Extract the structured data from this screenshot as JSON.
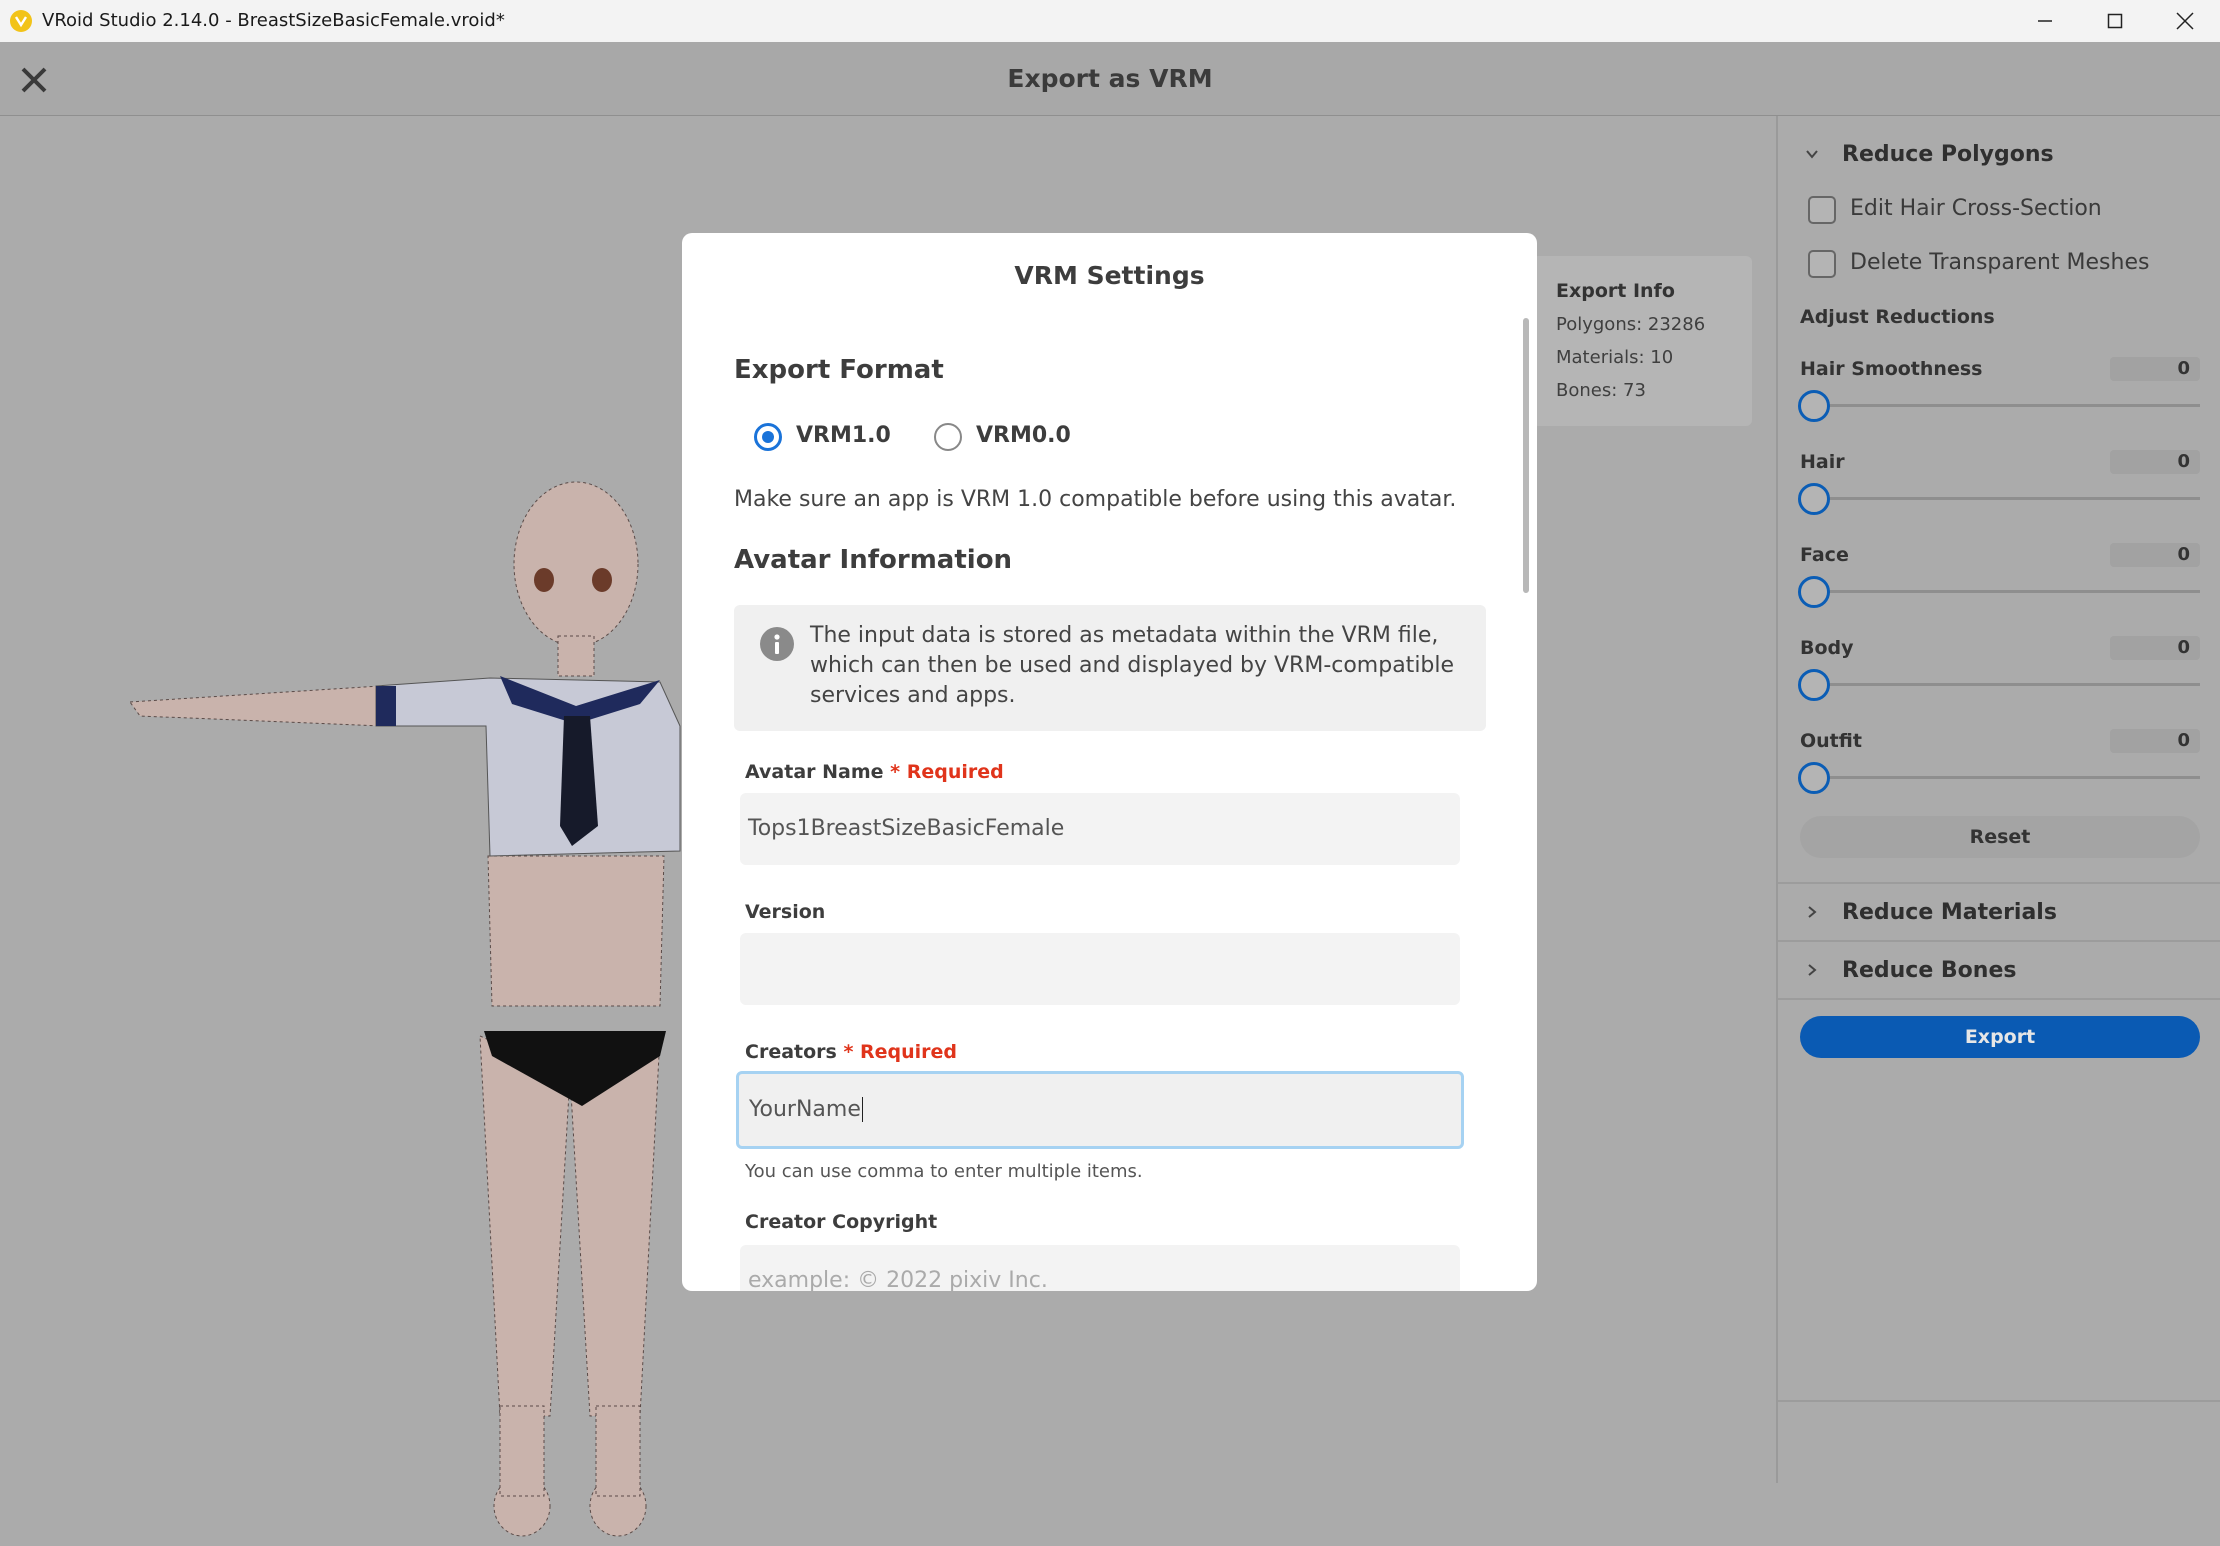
{
  "window": {
    "title": "VRoid Studio 2.14.0 - BreastSizeBasicFemale.vroid*"
  },
  "header": {
    "title": "Export as VRM"
  },
  "export_info": {
    "title": "Export Info",
    "polygons": "Polygons: 23286",
    "materials": "Materials: 10",
    "bones": "Bones: 73"
  },
  "panel": {
    "reduce_polygons": "Reduce Polygons",
    "edit_hair_cross_section": "Edit Hair Cross-Section",
    "delete_transparent_meshes": "Delete Transparent Meshes",
    "adjust_reductions": "Adjust Reductions",
    "sliders": [
      {
        "label": "Hair Smoothness",
        "value": "0"
      },
      {
        "label": "Hair",
        "value": "0"
      },
      {
        "label": "Face",
        "value": "0"
      },
      {
        "label": "Body",
        "value": "0"
      },
      {
        "label": "Outfit",
        "value": "0"
      }
    ],
    "reset": "Reset",
    "reduce_materials": "Reduce Materials",
    "reduce_bones": "Reduce Bones",
    "export": "Export"
  },
  "modal": {
    "title": "VRM Settings",
    "export_format": "Export Format",
    "vrm1": "VRM1.0",
    "vrm0": "VRM0.0",
    "compat_note": "Make sure an app is VRM 1.0 compatible before using this avatar.",
    "avatar_information": "Avatar Information",
    "info_text": "The input data is stored as metadata within the VRM file, which can then be used and displayed by VRM-compatible services and apps.",
    "avatar_name_label": "Avatar Name",
    "required": "* Required",
    "avatar_name_value": "Tops1BreastSizeBasicFemale",
    "version_label": "Version",
    "version_value": "",
    "creators_label": "Creators",
    "creators_value": "YourName",
    "creators_hint": "You can use comma to enter multiple items.",
    "copyright_label": "Creator Copyright",
    "copyright_placeholder": "example: ©     2022 pixiv Inc."
  },
  "colors": {
    "accent": "#0a5ab3",
    "required": "#e0341b",
    "logo": "#f2c318"
  }
}
